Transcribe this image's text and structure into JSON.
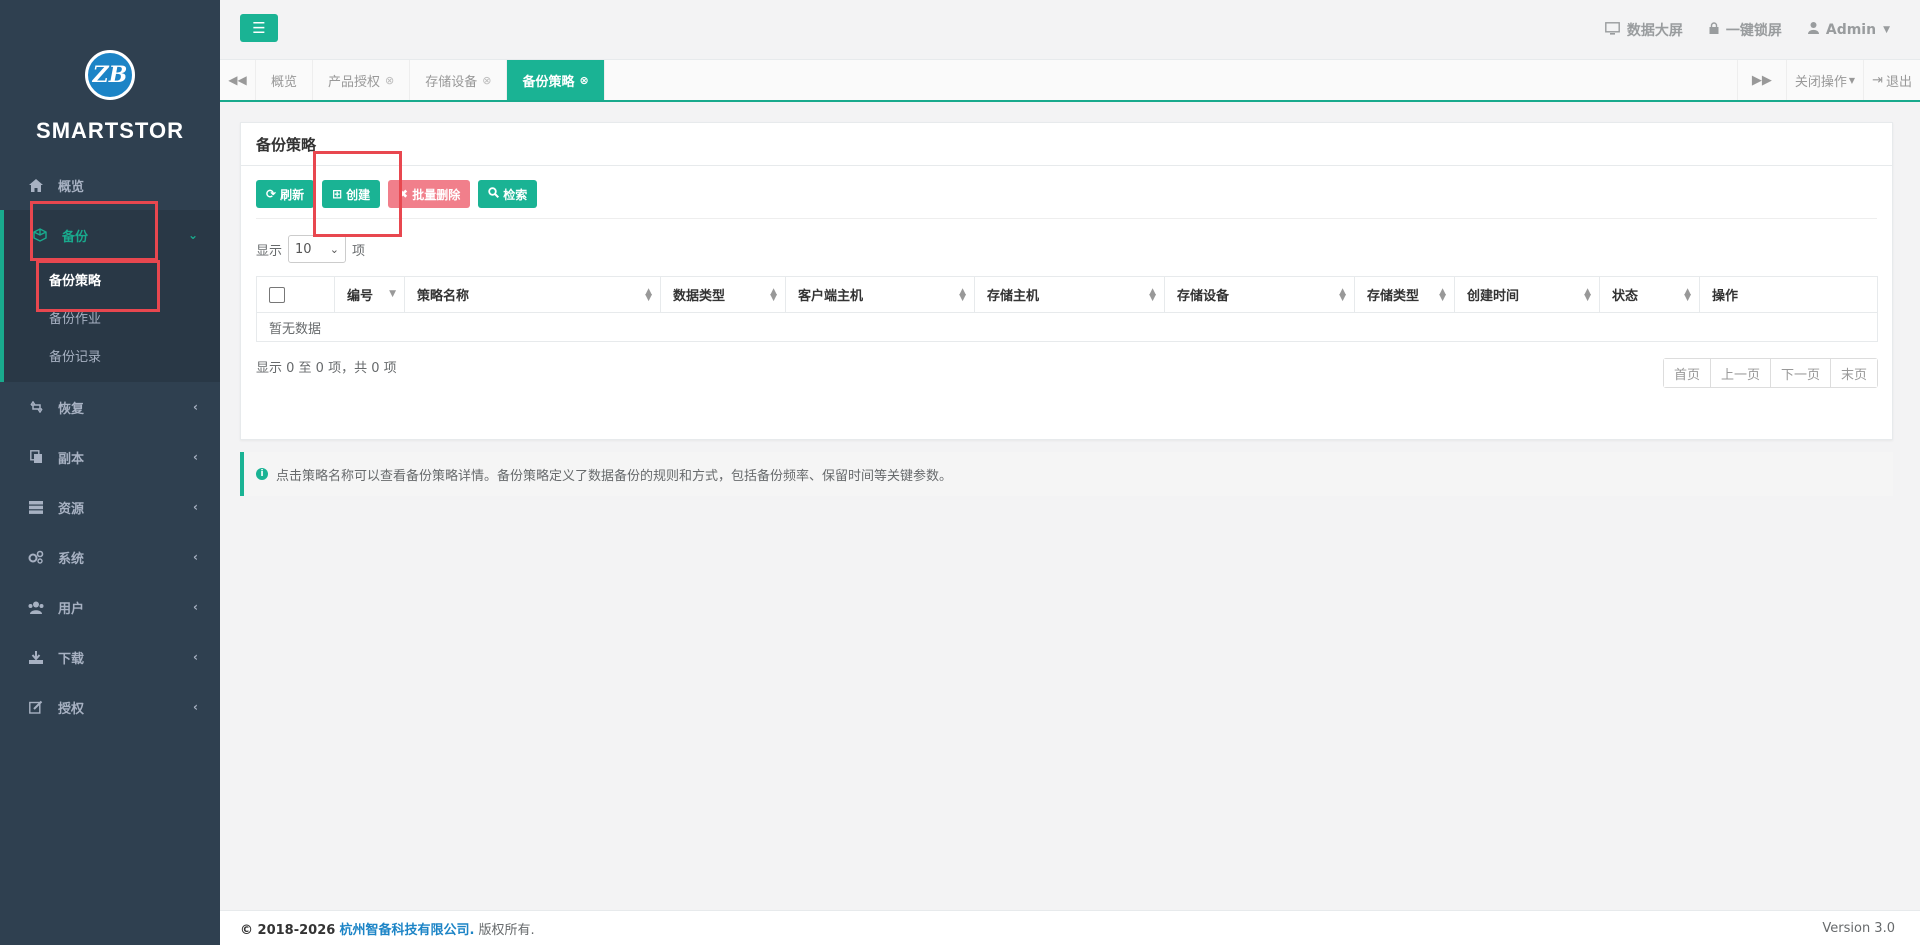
{
  "sidebar": {
    "logo_letters": "ZB",
    "brand": "SMARTSTOR",
    "items": [
      {
        "label": "概览",
        "icon": "home-icon"
      },
      {
        "label": "备份",
        "icon": "cube-icon"
      },
      {
        "label": "恢复",
        "icon": "retweet-icon"
      },
      {
        "label": "副本",
        "icon": "copy-icon"
      },
      {
        "label": "资源",
        "icon": "server-icon"
      },
      {
        "label": "系统",
        "icon": "gears-icon"
      },
      {
        "label": "用户",
        "icon": "users-icon"
      },
      {
        "label": "下载",
        "icon": "download-icon"
      },
      {
        "label": "授权",
        "icon": "edit-icon"
      }
    ],
    "backup_submenu": [
      "备份策略",
      "备份作业",
      "备份记录"
    ]
  },
  "topbar": {
    "dashboard": "数据大屏",
    "lock": "一键锁屏",
    "user": "Admin"
  },
  "tabs": {
    "items": [
      "概览",
      "产品授权",
      "存储设备",
      "备份策略"
    ],
    "close_ops": "关闭操作",
    "logout": "退出"
  },
  "panel": {
    "title": "备份策略",
    "buttons": {
      "refresh": "刷新",
      "create": "创建",
      "batch_delete": "批量删除",
      "search": "检索"
    },
    "length": {
      "prefix": "显示",
      "value": "10",
      "suffix": "项"
    },
    "columns": [
      "编号",
      "策略名称",
      "数据类型",
      "客户端主机",
      "存储主机",
      "存储设备",
      "存储类型",
      "创建时间",
      "状态",
      "操作"
    ],
    "empty": "暂无数据",
    "info": "显示 0 至 0 项，共 0 项",
    "pager": [
      "首页",
      "上一页",
      "下一页",
      "末页"
    ]
  },
  "hint": "点击策略名称可以查看备份策略详情。备份策略定义了数据备份的规则和方式，包括备份频率、保留时间等关键参数。",
  "footer": {
    "copyright": "© 2018-2026",
    "company": "杭州智备科技有限公司.",
    "rights": "版权所有.",
    "version": "Version 3.0"
  },
  "colors": {
    "accent": "#1ab394",
    "sidebar": "#2f4050",
    "danger": "#ed5565",
    "annotation": "#e8474f"
  }
}
